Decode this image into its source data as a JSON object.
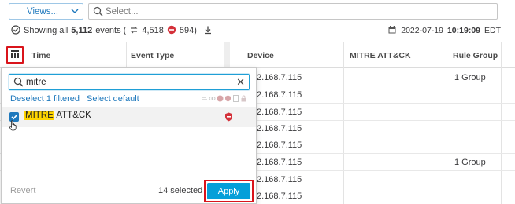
{
  "toolbar": {
    "views_label": "Views...",
    "search_placeholder": "Select..."
  },
  "status": {
    "showing_prefix": "Showing all",
    "showing_count": "5,112",
    "showing_suffix": "events (",
    "correlated_count": "4,518",
    "threat_count": "594)",
    "timestamp_date": "2022-07-19",
    "timestamp_time": "10:19:09",
    "timestamp_tz": "EDT"
  },
  "grid": {
    "headers": {
      "time": "Time",
      "event_type": "Event Type",
      "device": "Device",
      "mitre": "MITRE ATT&CK",
      "rule_group": "Rule Group"
    },
    "rows": [
      {
        "device": "2.168.7.115",
        "rule_group": "1 Group"
      },
      {
        "device": "2.168.7.115",
        "rule_group": ""
      },
      {
        "device": "2.168.7.115",
        "rule_group": ""
      },
      {
        "device": "2.168.7.115",
        "rule_group": ""
      },
      {
        "device": "2.168.7.115",
        "rule_group": ""
      },
      {
        "device": "2.168.7.115",
        "rule_group": "1 Group"
      },
      {
        "device": "2.168.7.115",
        "rule_group": ""
      },
      {
        "device": "2.168.7.115",
        "rule_group": ""
      }
    ]
  },
  "column_chooser": {
    "search_value": "mitre",
    "deselect_label": "Deselect 1 filtered",
    "select_default_label": "Select default",
    "option_highlight": "MITRE",
    "option_rest": " ATT&CK",
    "option_checked": true,
    "revert_label": "Revert",
    "selected_count": "14 selected",
    "apply_label": "Apply"
  },
  "colors": {
    "accent": "#049fd9",
    "link": "#1f79bd",
    "callout": "#d9141b",
    "highlight": "#ffd400",
    "threat": "#d4313a"
  }
}
